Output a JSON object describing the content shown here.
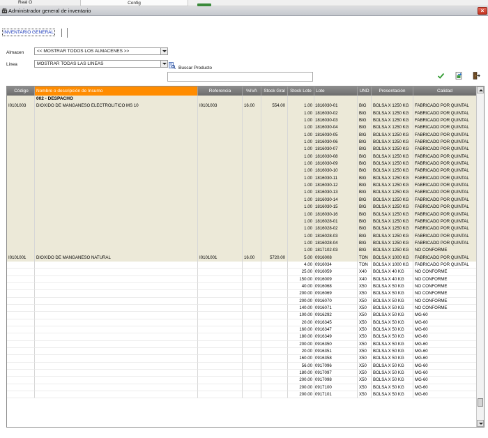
{
  "topstrip": {
    "left_text": "Real O",
    "tab_text": "Config"
  },
  "window": {
    "title": "Administrador general de inventario",
    "close_label": "×"
  },
  "tabs": {
    "active": "INVENTARIO GENERAL"
  },
  "filters": {
    "almacen_label": "Almacen",
    "almacen_value": "<< MOSTRAR TODOS LOS ALMACENES >>",
    "linea_label": "Linea",
    "linea_value": "MOSTRAR TODAS LAS LINEAS",
    "buscar_label": "Buscar Producto",
    "buscar_value": ""
  },
  "icons": {
    "search": "search-doc-icon",
    "confirm": "check-icon",
    "export": "export-icon",
    "exit": "exit-icon"
  },
  "colors": {
    "header": "#7c7c7c",
    "selected_header": "#ff8c00",
    "group_row": "#ece9d8"
  },
  "table": {
    "headers": [
      "Código",
      "Nombre o descripción de Insumo",
      "Referencia",
      "%IVA",
      "Stock Gral",
      "Stock Lote",
      "Lote",
      "UND",
      "Presentación",
      "Calidad"
    ],
    "group": "002 - DESPACHO",
    "rows": [
      {
        "cod": "I0101003",
        "nom": "DIOXIDO DE MANGANESO ELECTROLITICO MS 10",
        "ref": "I0101003",
        "iva": "16.00",
        "sg": "554.00",
        "sl": "1.00",
        "lote": "1816030-01",
        "und": "BIG",
        "pre": "BOLSA X 1250 KG",
        "cal": "FABRICADO POR QUINTAL",
        "s": "tan"
      },
      {
        "cod": "",
        "nom": "",
        "ref": "",
        "iva": "",
        "sg": "",
        "sl": "1.00",
        "lote": "1816030-02",
        "und": "BIG",
        "pre": "BOLSA X 1250 KG",
        "cal": "FABRICADO POR QUINTAL",
        "s": "tan"
      },
      {
        "cod": "",
        "nom": "",
        "ref": "",
        "iva": "",
        "sg": "",
        "sl": "1.00",
        "lote": "1816030-03",
        "und": "BIG",
        "pre": "BOLSA X 1250 KG",
        "cal": "FABRICADO POR QUINTAL",
        "s": "tan"
      },
      {
        "cod": "",
        "nom": "",
        "ref": "",
        "iva": "",
        "sg": "",
        "sl": "1.00",
        "lote": "1816030-04",
        "und": "BIG",
        "pre": "BOLSA X 1250 KG",
        "cal": "FABRICADO POR QUINTAL",
        "s": "tan"
      },
      {
        "cod": "",
        "nom": "",
        "ref": "",
        "iva": "",
        "sg": "",
        "sl": "1.00",
        "lote": "1816030-05",
        "und": "BIG",
        "pre": "BOLSA X 1250 KG",
        "cal": "FABRICADO POR QUINTAL",
        "s": "tan"
      },
      {
        "cod": "",
        "nom": "",
        "ref": "",
        "iva": "",
        "sg": "",
        "sl": "1.00",
        "lote": "1816030-06",
        "und": "BIG",
        "pre": "BOLSA X 1250 KG",
        "cal": "FABRICADO POR QUINTAL",
        "s": "tan"
      },
      {
        "cod": "",
        "nom": "",
        "ref": "",
        "iva": "",
        "sg": "",
        "sl": "1.00",
        "lote": "1816030-07",
        "und": "BIG",
        "pre": "BOLSA X 1250 KG",
        "cal": "FABRICADO POR QUINTAL",
        "s": "tan"
      },
      {
        "cod": "",
        "nom": "",
        "ref": "",
        "iva": "",
        "sg": "",
        "sl": "1.00",
        "lote": "1816030-08",
        "und": "BIG",
        "pre": "BOLSA X 1250 KG",
        "cal": "FABRICADO POR QUINTAL",
        "s": "tan"
      },
      {
        "cod": "",
        "nom": "",
        "ref": "",
        "iva": "",
        "sg": "",
        "sl": "1.00",
        "lote": "1816030-09",
        "und": "BIG",
        "pre": "BOLSA X 1250 KG",
        "cal": "FABRICADO POR QUINTAL",
        "s": "tan"
      },
      {
        "cod": "",
        "nom": "",
        "ref": "",
        "iva": "",
        "sg": "",
        "sl": "1.00",
        "lote": "1816030-10",
        "und": "BIG",
        "pre": "BOLSA X 1250 KG",
        "cal": "FABRICADO POR QUINTAL",
        "s": "tan"
      },
      {
        "cod": "",
        "nom": "",
        "ref": "",
        "iva": "",
        "sg": "",
        "sl": "1.00",
        "lote": "1816030-11",
        "und": "BIG",
        "pre": "BOLSA X 1250 KG",
        "cal": "FABRICADO POR QUINTAL",
        "s": "tan"
      },
      {
        "cod": "",
        "nom": "",
        "ref": "",
        "iva": "",
        "sg": "",
        "sl": "1.00",
        "lote": "1816030-12",
        "und": "BIG",
        "pre": "BOLSA X 1250 KG",
        "cal": "FABRICADO POR QUINTAL",
        "s": "tan"
      },
      {
        "cod": "",
        "nom": "",
        "ref": "",
        "iva": "",
        "sg": "",
        "sl": "1.00",
        "lote": "1816030-13",
        "und": "BIG",
        "pre": "BOLSA X 1250 KG",
        "cal": "FABRICADO POR QUINTAL",
        "s": "tan"
      },
      {
        "cod": "",
        "nom": "",
        "ref": "",
        "iva": "",
        "sg": "",
        "sl": "1.00",
        "lote": "1816030-14",
        "und": "BIG",
        "pre": "BOLSA X 1250 KG",
        "cal": "FABRICADO POR QUINTAL",
        "s": "tan"
      },
      {
        "cod": "",
        "nom": "",
        "ref": "",
        "iva": "",
        "sg": "",
        "sl": "1.00",
        "lote": "1816030-15",
        "und": "BIG",
        "pre": "BOLSA X 1250 KG",
        "cal": "FABRICADO POR QUINTAL",
        "s": "tan"
      },
      {
        "cod": "",
        "nom": "",
        "ref": "",
        "iva": "",
        "sg": "",
        "sl": "1.00",
        "lote": "1816030-16",
        "und": "BIG",
        "pre": "BOLSA X 1250 KG",
        "cal": "FABRICADO POR QUINTAL",
        "s": "tan"
      },
      {
        "cod": "",
        "nom": "",
        "ref": "",
        "iva": "",
        "sg": "",
        "sl": "1.00",
        "lote": "1816028-01",
        "und": "BIG",
        "pre": "BOLSA X 1250 KG",
        "cal": "FABRICADO POR QUINTAL",
        "s": "tan"
      },
      {
        "cod": "",
        "nom": "",
        "ref": "",
        "iva": "",
        "sg": "",
        "sl": "1.00",
        "lote": "1816028-02",
        "und": "BIG",
        "pre": "BOLSA X 1250 KG",
        "cal": "FABRICADO POR QUINTAL",
        "s": "tan"
      },
      {
        "cod": "",
        "nom": "",
        "ref": "",
        "iva": "",
        "sg": "",
        "sl": "1.00",
        "lote": "1816028-03",
        "und": "BIG",
        "pre": "BOLSA X 1250 KG",
        "cal": "FABRICADO POR QUINTAL",
        "s": "tan"
      },
      {
        "cod": "",
        "nom": "",
        "ref": "",
        "iva": "",
        "sg": "",
        "sl": "1.00",
        "lote": "1816028-04",
        "und": "BIG",
        "pre": "BOLSA X 1250 KG",
        "cal": "FABRICADO POR QUINTAL",
        "s": "tan"
      },
      {
        "cod": "",
        "nom": "",
        "ref": "",
        "iva": "",
        "sg": "",
        "sl": "1.00",
        "lote": "1817102-03",
        "und": "BIG",
        "pre": "BOLSA X 1250 KG",
        "cal": "NO CONFORME",
        "s": "tan"
      },
      {
        "cod": "I0101001",
        "nom": "DIOXIDO DE MANGANESO NATURAL",
        "ref": "I0101001",
        "iva": "16.00",
        "sg": "5720.00",
        "sl": "5.00",
        "lote": "0916008",
        "und": "TON",
        "pre": "BOLSA X 1000 KG",
        "cal": "FABRICADO POR QUINTAL",
        "s": "tan"
      },
      {
        "cod": "",
        "nom": "",
        "ref": "",
        "iva": "",
        "sg": "",
        "sl": "4.00",
        "lote": "0916034",
        "und": "TON",
        "pre": "BOLSA X 1000 KG",
        "cal": "FABRICADO POR QUINTAL",
        "s": "plain"
      },
      {
        "cod": "",
        "nom": "",
        "ref": "",
        "iva": "",
        "sg": "",
        "sl": "25.00",
        "lote": "0916059",
        "und": "X40",
        "pre": "BOLSA X 40 KG",
        "cal": "NO CONFORME",
        "s": "plain"
      },
      {
        "cod": "",
        "nom": "",
        "ref": "",
        "iva": "",
        "sg": "",
        "sl": "150.00",
        "lote": "0916009",
        "und": "X40",
        "pre": "BOLSA X 40 KG",
        "cal": "NO CONFORME",
        "s": "plain"
      },
      {
        "cod": "",
        "nom": "",
        "ref": "",
        "iva": "",
        "sg": "",
        "sl": "40.00",
        "lote": "0916068",
        "und": "X50",
        "pre": "BOLSA X 50 KG",
        "cal": "NO CONFORME",
        "s": "plain"
      },
      {
        "cod": "",
        "nom": "",
        "ref": "",
        "iva": "",
        "sg": "",
        "sl": "200.00",
        "lote": "0916069",
        "und": "X50",
        "pre": "BOLSA X 50 KG",
        "cal": "NO CONFORME",
        "s": "plain"
      },
      {
        "cod": "",
        "nom": "",
        "ref": "",
        "iva": "",
        "sg": "",
        "sl": "200.00",
        "lote": "0916070",
        "und": "X50",
        "pre": "BOLSA X 50 KG",
        "cal": "NO CONFORME",
        "s": "plain"
      },
      {
        "cod": "",
        "nom": "",
        "ref": "",
        "iva": "",
        "sg": "",
        "sl": "140.00",
        "lote": "0916071",
        "und": "X50",
        "pre": "BOLSA X 50 KG",
        "cal": "NO CONFORME",
        "s": "plain"
      },
      {
        "cod": "",
        "nom": "",
        "ref": "",
        "iva": "",
        "sg": "",
        "sl": "100.00",
        "lote": "0916292",
        "und": "X50",
        "pre": "BOLSA X 50 KG",
        "cal": "MG-60",
        "s": "plain"
      },
      {
        "cod": "",
        "nom": "",
        "ref": "",
        "iva": "",
        "sg": "",
        "sl": "20.00",
        "lote": "0916345",
        "und": "X50",
        "pre": "BOLSA X 50 KG",
        "cal": "MG-60",
        "s": "plain"
      },
      {
        "cod": "",
        "nom": "",
        "ref": "",
        "iva": "",
        "sg": "",
        "sl": "160.00",
        "lote": "0916347",
        "und": "X50",
        "pre": "BOLSA X 50 KG",
        "cal": "MG-60",
        "s": "plain"
      },
      {
        "cod": "",
        "nom": "",
        "ref": "",
        "iva": "",
        "sg": "",
        "sl": "180.00",
        "lote": "0916349",
        "und": "X50",
        "pre": "BOLSA X 50 KG",
        "cal": "MG-60",
        "s": "plain"
      },
      {
        "cod": "",
        "nom": "",
        "ref": "",
        "iva": "",
        "sg": "",
        "sl": "200.00",
        "lote": "0916350",
        "und": "X50",
        "pre": "BOLSA X 50 KG",
        "cal": "MG-60",
        "s": "plain"
      },
      {
        "cod": "",
        "nom": "",
        "ref": "",
        "iva": "",
        "sg": "",
        "sl": "20.00",
        "lote": "0916351",
        "und": "X50",
        "pre": "BOLSA X 50 KG",
        "cal": "MG-60",
        "s": "plain"
      },
      {
        "cod": "",
        "nom": "",
        "ref": "",
        "iva": "",
        "sg": "",
        "sl": "160.00",
        "lote": "0916358",
        "und": "X50",
        "pre": "BOLSA X 50 KG",
        "cal": "MG-60",
        "s": "plain"
      },
      {
        "cod": "",
        "nom": "",
        "ref": "",
        "iva": "",
        "sg": "",
        "sl": "56.00",
        "lote": "0917096",
        "und": "X50",
        "pre": "BOLSA X 50 KG",
        "cal": "MG-60",
        "s": "plain"
      },
      {
        "cod": "",
        "nom": "",
        "ref": "",
        "iva": "",
        "sg": "",
        "sl": "180.00",
        "lote": "0917097",
        "und": "X50",
        "pre": "BOLSA X 50 KG",
        "cal": "MG-60",
        "s": "plain"
      },
      {
        "cod": "",
        "nom": "",
        "ref": "",
        "iva": "",
        "sg": "",
        "sl": "200.00",
        "lote": "0917098",
        "und": "X50",
        "pre": "BOLSA X 50 KG",
        "cal": "MG-60",
        "s": "plain"
      },
      {
        "cod": "",
        "nom": "",
        "ref": "",
        "iva": "",
        "sg": "",
        "sl": "200.00",
        "lote": "0917100",
        "und": "X50",
        "pre": "BOLSA X 50 KG",
        "cal": "MG-60",
        "s": "plain"
      },
      {
        "cod": "",
        "nom": "",
        "ref": "",
        "iva": "",
        "sg": "",
        "sl": "200.00",
        "lote": "0917101",
        "und": "X50",
        "pre": "BOLSA X 50 KG",
        "cal": "MG-60",
        "s": "plain"
      }
    ]
  }
}
